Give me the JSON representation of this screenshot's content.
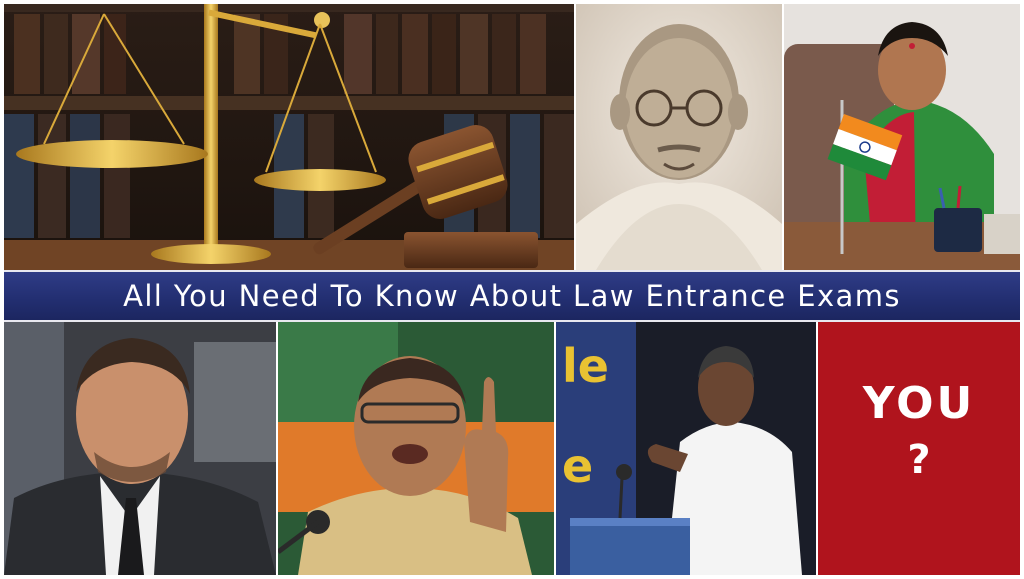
{
  "banner": {
    "title": "All You Need To Know About Law Entrance Exams"
  },
  "you_panel": {
    "word": "YOU",
    "mark": "?"
  },
  "colors": {
    "banner_blue": "#232f72",
    "you_red": "#b0141d",
    "gold": "#d9a93a",
    "flag_saffron": "#f28a1e",
    "flag_green": "#1f8a3a",
    "wood": "#6b3f22"
  }
}
